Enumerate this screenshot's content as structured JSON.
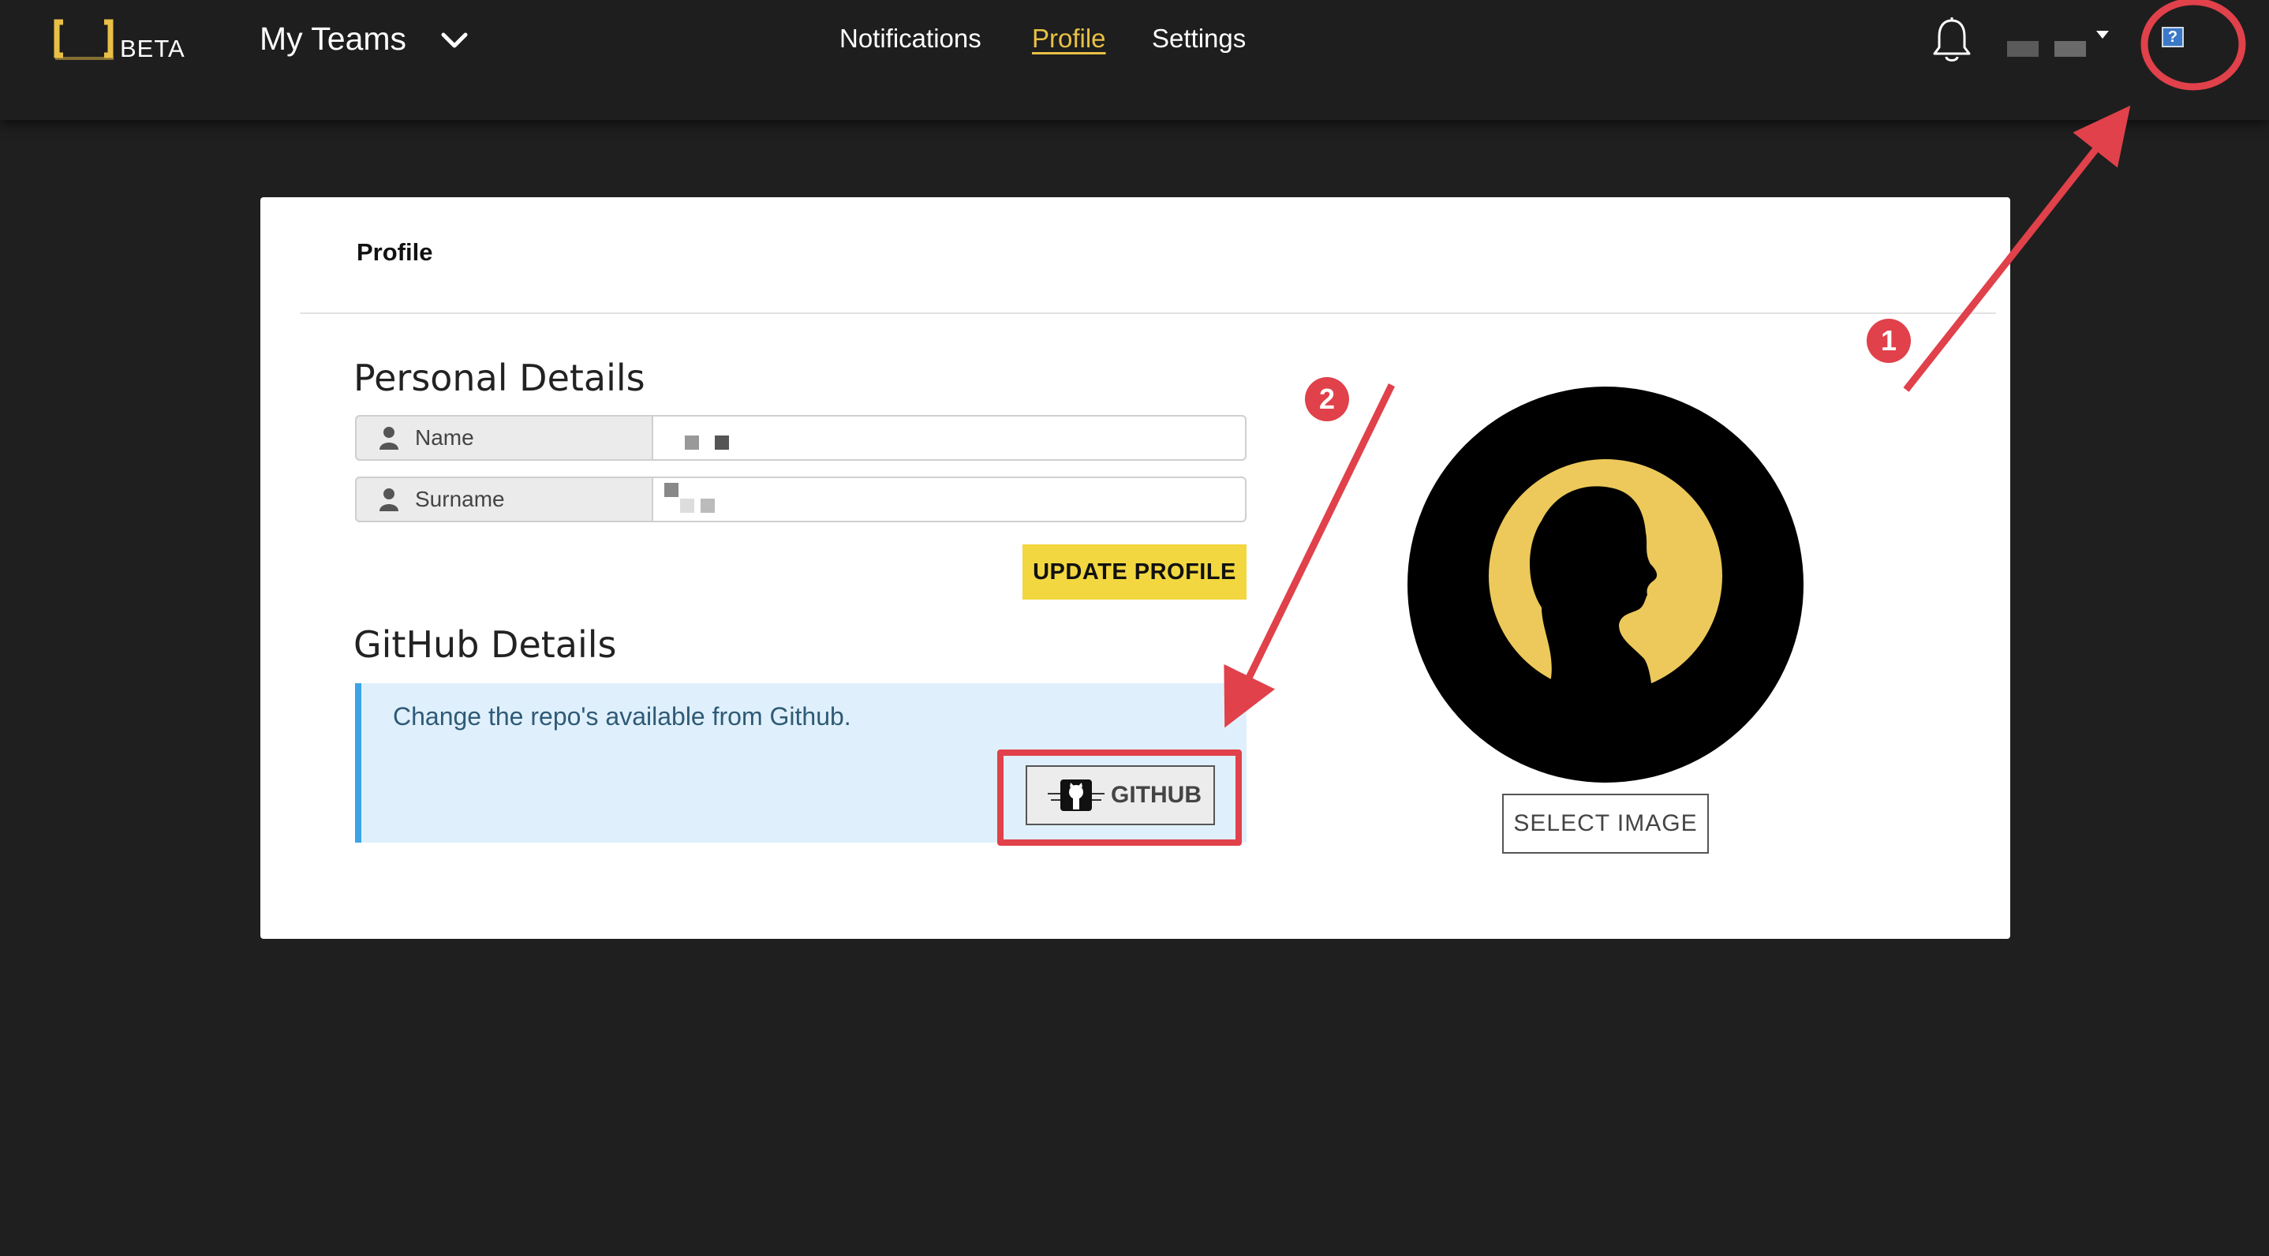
{
  "nav": {
    "logo_text": "BETA",
    "teams_label": "My Teams",
    "links": {
      "notifications": "Notifications",
      "profile": "Profile",
      "settings": "Settings"
    },
    "help_icon_text": "?"
  },
  "card": {
    "title": "Profile",
    "personal": {
      "heading": "Personal Details",
      "name_label": "Name",
      "surname_label": "Surname",
      "update_button": "UPDATE PROFILE"
    },
    "github": {
      "heading": "GitHub Details",
      "description": "Change the repo's available from Github.",
      "button": "GITHUB"
    },
    "avatar": {
      "select_button": "SELECT IMAGE"
    }
  },
  "annotations": {
    "badge_1": "1",
    "badge_2": "2",
    "color": "#e0414a"
  },
  "colors": {
    "accent": "#e8c046",
    "update_button": "#f2d740",
    "info_panel": "#dff0fc",
    "info_border": "#3aa4e6",
    "background": "#1f1f1f"
  }
}
